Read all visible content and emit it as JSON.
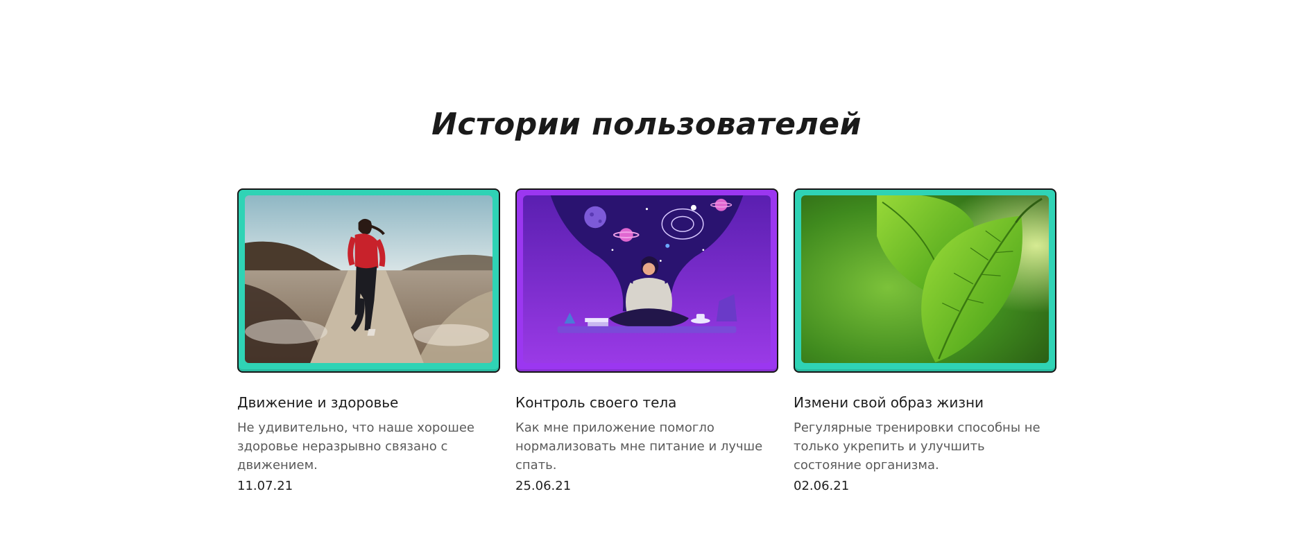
{
  "section": {
    "title": "Истории пользователей"
  },
  "cards": [
    {
      "title": "Движение и здоровье",
      "text": "Не удивительно, что наше хорошее здоровье неразрывно связано с движением.",
      "date": "11.07.21"
    },
    {
      "title": "Контроль своего тела",
      "text": "Как мне приложение помогло нормализовать мне питание и лучше спать.",
      "date": "25.06.21"
    },
    {
      "title": "Измени свой образ жизни",
      "text": "Регулярные тренировки способны не только укрепить и улучшить состояние организма.",
      "date": "02.06.21"
    }
  ],
  "colors": {
    "frame_teal": "#2fd3b5",
    "frame_purple": "#9b37f0",
    "outline": "#161616"
  }
}
